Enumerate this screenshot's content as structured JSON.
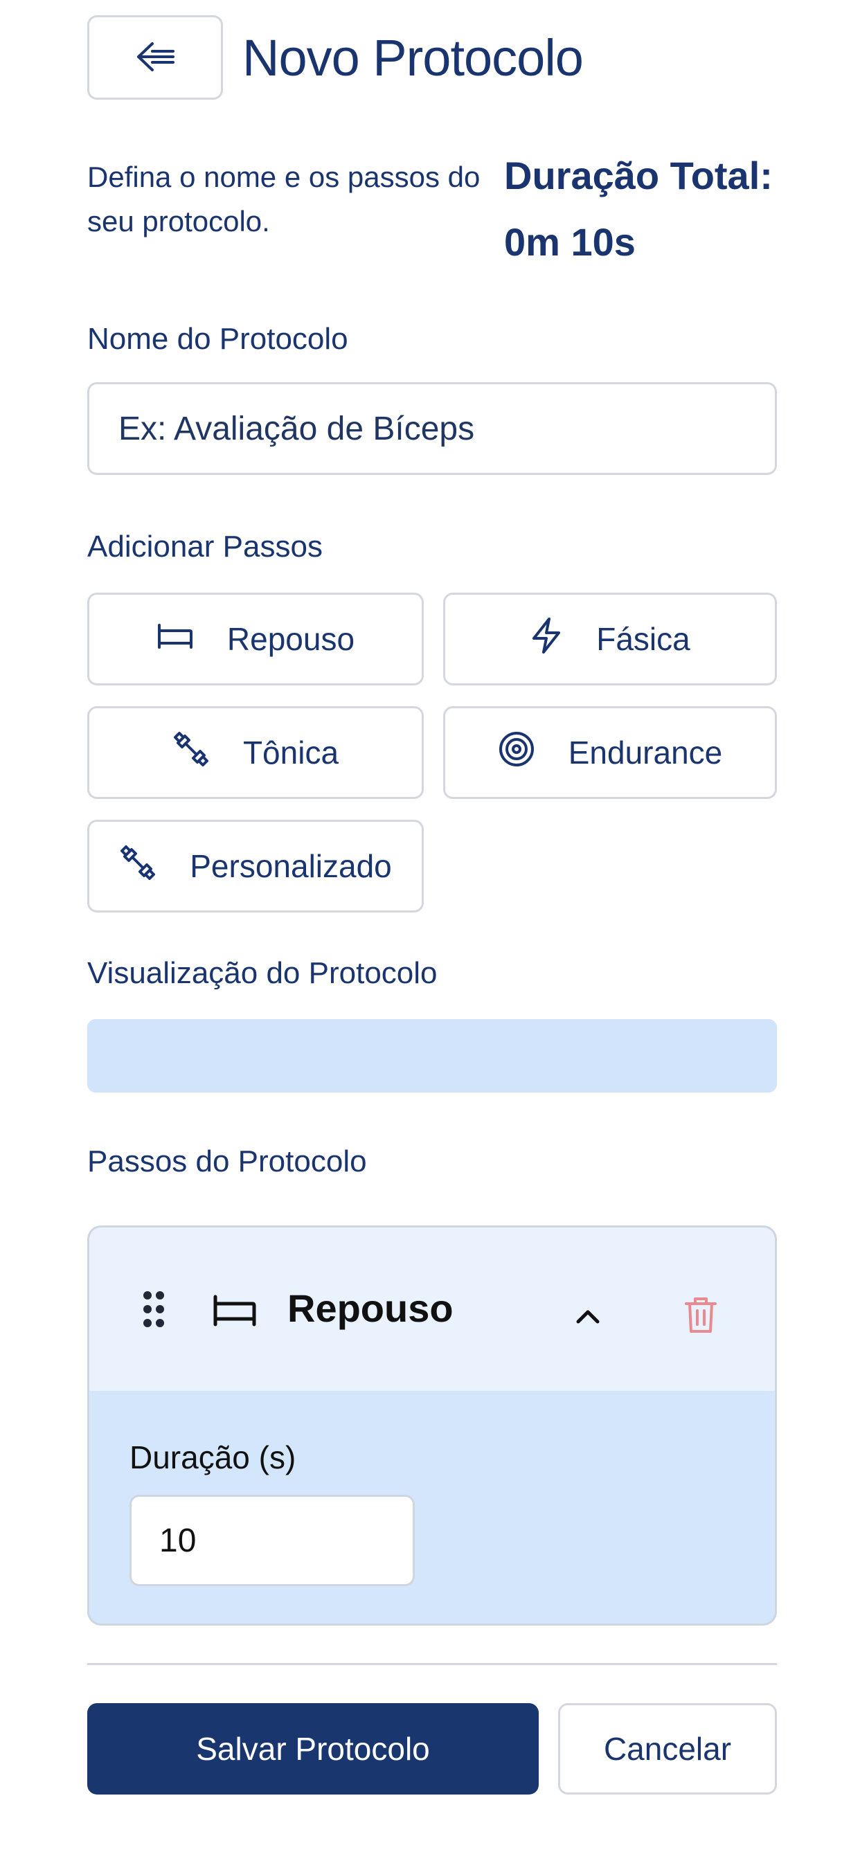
{
  "header": {
    "title": "Novo Protocolo",
    "back_icon": "arrow-left-icon"
  },
  "intro": {
    "subtitle": "Defina o nome e os passos do seu protocolo.",
    "total_label": "Duração Total: 0m 10s"
  },
  "name_field": {
    "label": "Nome do Protocolo",
    "placeholder": "Ex: Avaliação de Bíceps",
    "value": ""
  },
  "add_steps": {
    "label": "Adicionar Passos",
    "buttons": [
      {
        "label": "Repouso",
        "icon": "bed-icon"
      },
      {
        "label": "Fásica",
        "icon": "lightning-icon"
      },
      {
        "label": "Tônica",
        "icon": "dumbbell-icon"
      },
      {
        "label": "Endurance",
        "icon": "target-icon"
      },
      {
        "label": "Personalizado",
        "icon": "dumbbell-icon"
      }
    ]
  },
  "preview": {
    "label": "Visualização do Protocolo"
  },
  "steps": {
    "label": "Passos do Protocolo",
    "items": [
      {
        "name": "Repouso",
        "icon": "bed-icon",
        "duration_label": "Duração (s)",
        "duration_value": "10",
        "expanded": true
      }
    ]
  },
  "footer": {
    "save_label": "Salvar Protocolo",
    "cancel_label": "Cancelar"
  },
  "colors": {
    "primary": "#19366f",
    "text": "#1a3470",
    "preview_bar": "#d1e4fb",
    "card_body": "#d4e6fb",
    "card_head": "#e9f2fd",
    "delete": "#e88a8f",
    "border": "#d4d8de"
  }
}
